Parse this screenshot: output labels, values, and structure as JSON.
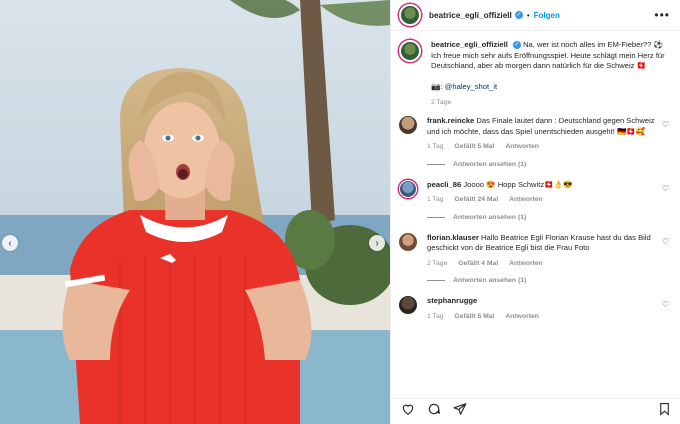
{
  "header": {
    "username": "beatrice_egli_offiziell",
    "follow_label": "Folgen",
    "separator": "•"
  },
  "caption": {
    "username": "beatrice_egli_offiziell",
    "text_line1": "Na, wer ist noch alles im EM-Fieber?? ⚽",
    "text_line2": "Ich freue mich sehr aufs Eröffnungsspiel. Heute schlägt mein Herz für Deutschland, aber ab morgen dann natürlich für die Schweiz 🇨🇭",
    "mention": "📷: @haley_shot_it",
    "time": "2 Tage"
  },
  "comments": [
    {
      "username": "frank.reincke",
      "text": "Das Finale lautet dann : Deutschland gegen Schweiz und ich möchte, dass das Spiel unentschieden ausgeht! 🇩🇪🇨🇭🥰",
      "time": "1 Tag",
      "likes": "Gefällt 5 Mal",
      "reply": "Antworten",
      "replies_label": "Antworten ansehen (1)"
    },
    {
      "username": "peacli_86",
      "text": "Joooo 😍 Hopp Schwitz🇨🇭👌😎",
      "time": "1 Tag",
      "likes": "Gefällt 24 Mal",
      "reply": "Antworten",
      "replies_label": "Antworten ansehen (1)"
    },
    {
      "username": "florian.klauser",
      "text": "Hallo Beatrice Egli Florian Krause hast du das Bild geschickt von dir Beatrice Egli bist die Frau Foto",
      "time": "2 Tage",
      "likes": "Gefällt 4 Mal",
      "reply": "Antworten",
      "replies_label": "Antworten ansehen (1)"
    },
    {
      "username": "stephanrugge",
      "text": "",
      "time": "1 Tag",
      "likes": "Gefällt 5 Mal",
      "reply": "Antworten"
    }
  ],
  "icons": {
    "more": "more-icon",
    "heart": "heart-icon",
    "comment": "comment-icon",
    "share": "share-icon",
    "save": "bookmark-icon",
    "prev": "chevron-left-icon",
    "next": "chevron-right-icon"
  },
  "colors": {
    "link": "#0095f6",
    "jersey_red": "#e8322a",
    "text": "#262626",
    "meta": "#8e8e8e"
  }
}
